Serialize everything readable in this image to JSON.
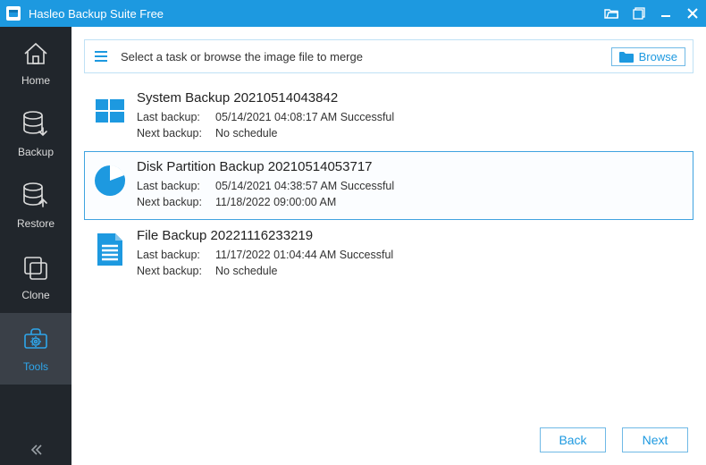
{
  "titlebar": {
    "app_name": "Hasleo Backup Suite Free"
  },
  "sidebar": {
    "items": [
      {
        "label": "Home"
      },
      {
        "label": "Backup"
      },
      {
        "label": "Restore"
      },
      {
        "label": "Clone"
      },
      {
        "label": "Tools"
      }
    ]
  },
  "instruction": {
    "text": "Select a task or browse the image file to merge",
    "browse_label": "Browse"
  },
  "tasks": [
    {
      "icon": "windows",
      "title": "System Backup 20210514043842",
      "last_label": "Last backup:",
      "last_value": "05/14/2021 04:08:17 AM Successful",
      "next_label": "Next backup:",
      "next_value": "No schedule",
      "selected": false
    },
    {
      "icon": "pie",
      "title": "Disk Partition Backup 20210514053717",
      "last_label": "Last backup:",
      "last_value": "05/14/2021 04:38:57 AM Successful",
      "next_label": "Next backup:",
      "next_value": "11/18/2022 09:00:00 AM",
      "selected": true
    },
    {
      "icon": "doc",
      "title": "File Backup 20221116233219",
      "last_label": "Last backup:",
      "last_value": "11/17/2022 01:04:44 AM Successful",
      "next_label": "Next backup:",
      "next_value": "No schedule",
      "selected": false
    }
  ],
  "footer": {
    "back_label": "Back",
    "next_label": "Next"
  }
}
